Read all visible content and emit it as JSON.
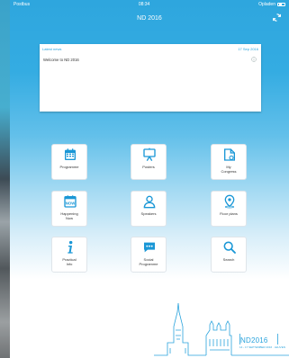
{
  "status_bar": {
    "carrier": "Postbus",
    "time": "08:34",
    "battery_label": "Opladen"
  },
  "nav": {
    "title": "ND 2016"
  },
  "news": {
    "header_title": "Latest news",
    "date": "17 Sep 2016",
    "message": "Welcome to ND 2016"
  },
  "tiles": [
    {
      "label": "Programme",
      "icon": "calendar-icon"
    },
    {
      "label": "Posters",
      "icon": "easel-icon"
    },
    {
      "label": "My\nCongress",
      "icon": "folder-icon"
    },
    {
      "label": "Happening\nNow",
      "icon": "calendar-now-icon"
    },
    {
      "label": "Speakers",
      "icon": "person-icon"
    },
    {
      "label": "Floor plans",
      "icon": "map-pin-icon"
    },
    {
      "label": "Practical\nInfo",
      "icon": "info-icon"
    },
    {
      "label": "Social\nProgramme",
      "icon": "chat-icon"
    },
    {
      "label": "Search",
      "icon": "search-icon"
    }
  ],
  "footer": {
    "logo_text": "ND2016",
    "logo_sub": "14 - 17 SEPTEMBER 2016 · LEUVEN"
  },
  "colors": {
    "accent": "#2aa3dc",
    "icon": "#1a97d6"
  }
}
